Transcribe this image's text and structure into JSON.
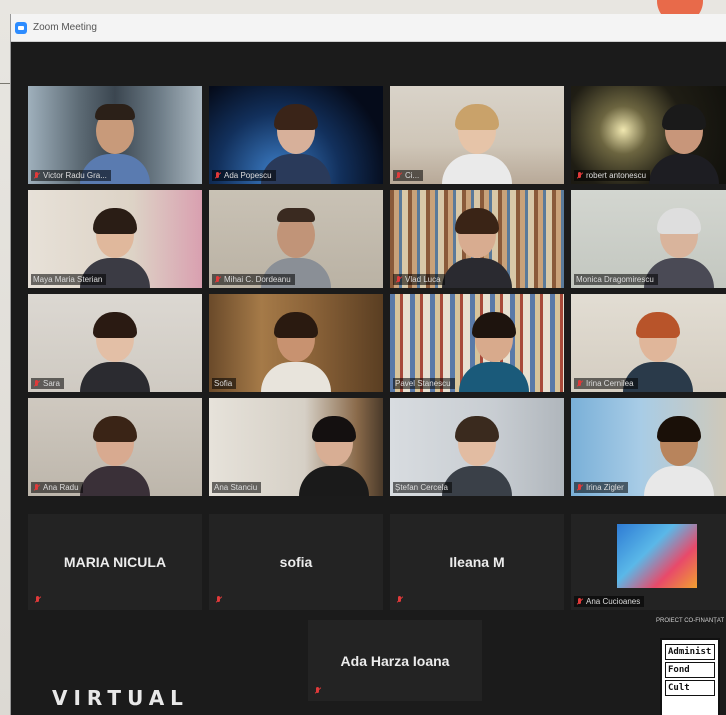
{
  "window": {
    "title": "Zoom Meeting"
  },
  "participants_video": [
    {
      "name": "Victor Radu Gra..."
    },
    {
      "name": "Ada Popescu"
    },
    {
      "name": "Ci..."
    },
    {
      "name": "robert antonescu"
    },
    {
      "name": "Maya Maria Sterian"
    },
    {
      "name": "Mihai C. Dordeanu"
    },
    {
      "name": "Vlad Luca"
    },
    {
      "name": "Monica Dragomirescu"
    },
    {
      "name": "Sara"
    },
    {
      "name": "Sofia"
    },
    {
      "name": "Pavel Stanescu"
    },
    {
      "name": "Irina Cernilea"
    },
    {
      "name": "Ana Radu"
    },
    {
      "name": "Ana Stanciu"
    },
    {
      "name": "Ștefan Cercela"
    },
    {
      "name": "Irina Zigler"
    }
  ],
  "participants_name_only": [
    {
      "name": "MARIA NICULA"
    },
    {
      "name": "sofia"
    },
    {
      "name": "Ileana M"
    },
    {
      "name": "Ada Harza Ioana"
    }
  ],
  "avatar_tile": {
    "name": "Ana Cucioanes"
  },
  "branding": {
    "virtual_logo": "VIRTUAL",
    "sponsor_title": "PROIECT CO-FINANȚAT DE",
    "sponsor_lines": [
      "Administ",
      "Fond",
      "Cult"
    ]
  },
  "colors": {
    "active_speaker": "#c8d24a",
    "muted_mic": "#e03a3a",
    "zoom_blue": "#2d8cff"
  }
}
